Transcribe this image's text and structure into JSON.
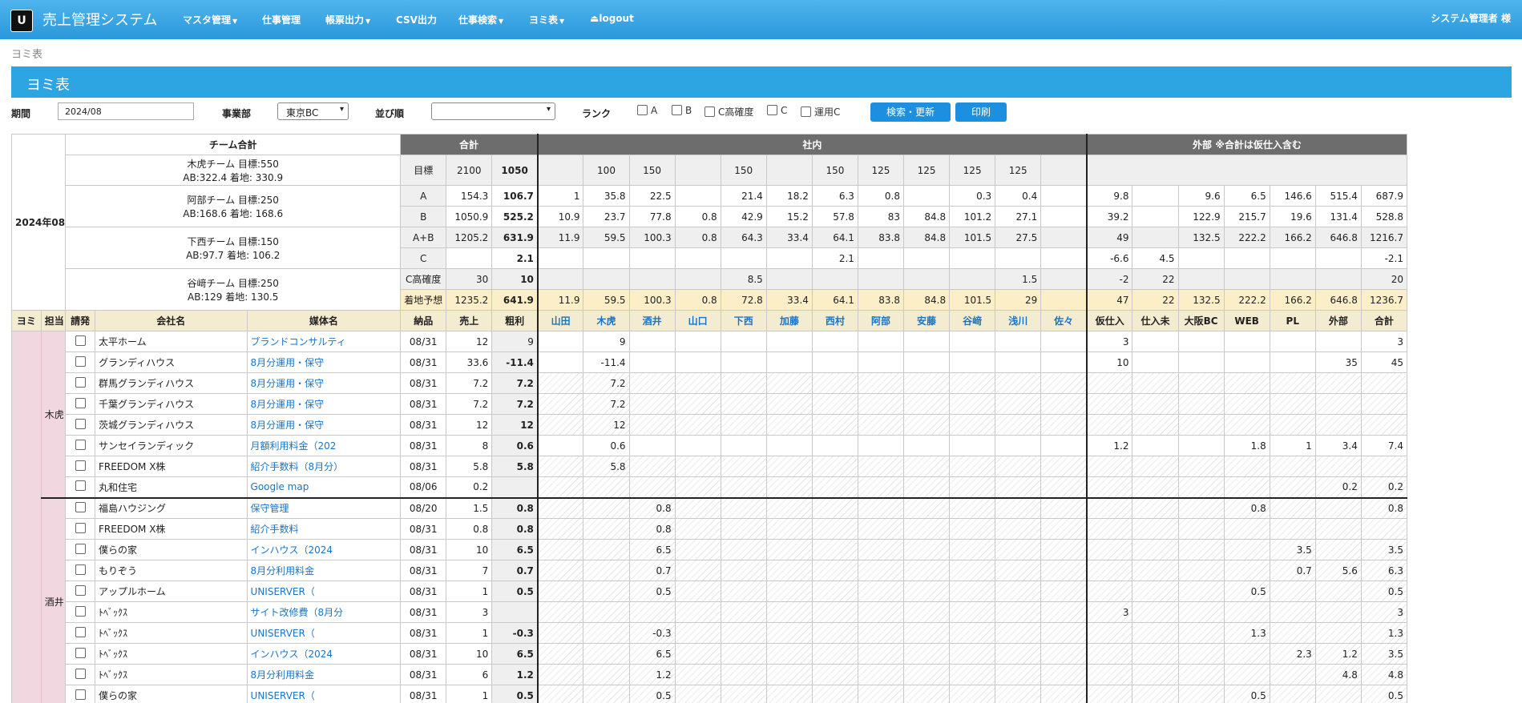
{
  "app": {
    "logo": "U",
    "title": "売上管理システム",
    "user": "システム管理者 様"
  },
  "nav": [
    {
      "label": "マスタ管理",
      "dropdown": true
    },
    {
      "label": "仕事管理",
      "dropdown": false
    },
    {
      "label": "帳票出力",
      "dropdown": true
    },
    {
      "label": "CSV出力",
      "dropdown": false
    },
    {
      "label": "仕事検索",
      "dropdown": true
    },
    {
      "label": "ヨミ表",
      "dropdown": true
    },
    {
      "label": "logout",
      "dropdown": false,
      "icon": "eject-icon"
    }
  ],
  "breadcrumb": "ヨミ表",
  "page_title": "ヨミ表",
  "filters": {
    "period_label": "期間",
    "period_value": "2024/08",
    "division_label": "事業部",
    "division_value": "東京BC",
    "sort_label": "並び順",
    "sort_value": "",
    "rank_label": "ランク",
    "rank_options": [
      "A",
      "B",
      "C高確度",
      "C",
      "運用C"
    ],
    "search_button": "検索・更新",
    "print_button": "印刷"
  },
  "summary": {
    "month": "2024年08月",
    "team_header": "チーム合計",
    "teams": [
      {
        "line1": "木虎チーム 目標:550",
        "line2": "AB:322.4 着地: 330.9"
      },
      {
        "line1": "阿部チーム 目標:250",
        "line2": "AB:168.6 着地: 168.6"
      },
      {
        "line1": "下西チーム 目標:150",
        "line2": "AB:97.7 着地: 106.2"
      },
      {
        "line1": "谷﨑チーム 目標:250",
        "line2": "AB:129 着地: 130.5"
      }
    ],
    "group_headers": {
      "total": "合計",
      "internal": "社内",
      "external": "外部 ※合計は仮仕入含む"
    },
    "rows": [
      {
        "label": "目標",
        "total": [
          "2100",
          "1050"
        ],
        "internal": [
          "",
          "100",
          "150",
          "",
          "150",
          "",
          "150",
          "125",
          "125",
          "125",
          "125",
          ""
        ],
        "external": [
          "",
          "",
          "",
          "",
          "",
          "",
          ""
        ]
      },
      {
        "label": "A",
        "total": [
          "154.3",
          "106.7"
        ],
        "internal": [
          "1",
          "35.8",
          "22.5",
          "",
          "21.4",
          "18.2",
          "6.3",
          "0.8",
          "",
          "0.3",
          "0.4",
          ""
        ],
        "external": [
          "9.8",
          "",
          "9.6",
          "6.5",
          "146.6",
          "515.4",
          "687.9"
        ]
      },
      {
        "label": "B",
        "total": [
          "1050.9",
          "525.2"
        ],
        "internal": [
          "10.9",
          "23.7",
          "77.8",
          "0.8",
          "42.9",
          "15.2",
          "57.8",
          "83",
          "84.8",
          "101.2",
          "27.1",
          ""
        ],
        "external": [
          "39.2",
          "",
          "122.9",
          "215.7",
          "19.6",
          "131.4",
          "528.8"
        ]
      },
      {
        "label": "A+B",
        "total": [
          "1205.2",
          "631.9"
        ],
        "internal": [
          "11.9",
          "59.5",
          "100.3",
          "0.8",
          "64.3",
          "33.4",
          "64.1",
          "83.8",
          "84.8",
          "101.5",
          "27.5",
          ""
        ],
        "external": [
          "49",
          "",
          "132.5",
          "222.2",
          "166.2",
          "646.8",
          "1216.7"
        ]
      },
      {
        "label": "C",
        "total": [
          "",
          "2.1"
        ],
        "internal": [
          "",
          "",
          "",
          "",
          "",
          "",
          "2.1",
          "",
          "",
          "",
          "",
          ""
        ],
        "external": [
          "-6.6",
          "4.5",
          "",
          "",
          "",
          "",
          "-2.1"
        ]
      },
      {
        "label": "C高確度",
        "total": [
          "30",
          "10"
        ],
        "internal": [
          "",
          "",
          "",
          "",
          "8.5",
          "",
          "",
          "",
          "",
          "",
          "1.5",
          ""
        ],
        "external": [
          "-2",
          "22",
          "",
          "",
          "",
          "",
          "20"
        ]
      },
      {
        "label": "着地予想",
        "total": [
          "1235.2",
          "641.9"
        ],
        "internal": [
          "11.9",
          "59.5",
          "100.3",
          "0.8",
          "72.8",
          "33.4",
          "64.1",
          "83.8",
          "84.8",
          "101.5",
          "29",
          ""
        ],
        "external": [
          "47",
          "22",
          "132.5",
          "222.2",
          "166.2",
          "646.8",
          "1236.7"
        ]
      }
    ]
  },
  "columns": {
    "left": [
      "ヨミ",
      "担当",
      "請発",
      "会社名",
      "媒体名",
      "納品",
      "売上",
      "粗利"
    ],
    "internal": [
      "山田",
      "木虎",
      "酒井",
      "山口",
      "下西",
      "加藤",
      "西村",
      "阿部",
      "安藤",
      "谷﨑",
      "浅川",
      "佐々"
    ],
    "external": [
      "仮仕入",
      "仕入未",
      "大阪BC",
      "WEB",
      "PL",
      "外部",
      "合計"
    ]
  },
  "groups": [
    {
      "person": "木虎",
      "rows": [
        {
          "company": "太平ホーム",
          "media": "ブランドコンサルティ",
          "date": "08/31",
          "sales": "12",
          "profit": "9",
          "profit_bold": false,
          "hatched": false,
          "internal": [
            "",
            "9",
            "",
            "",
            "",
            "",
            "",
            "",
            "",
            "",
            "",
            ""
          ],
          "external": [
            "3",
            "",
            "",
            "",
            "",
            "",
            "3"
          ]
        },
        {
          "company": "グランディハウス",
          "media": "8月分運用・保守",
          "date": "08/31",
          "sales": "33.6",
          "profit": "-11.4",
          "profit_bold": true,
          "hatched": false,
          "internal": [
            "",
            "-11.4",
            "",
            "",
            "",
            "",
            "",
            "",
            "",
            "",
            "",
            ""
          ],
          "external": [
            "10",
            "",
            "",
            "",
            "",
            "35",
            "45"
          ]
        },
        {
          "company": "群馬グランディハウス",
          "media": "8月分運用・保守",
          "date": "08/31",
          "sales": "7.2",
          "profit": "7.2",
          "profit_bold": true,
          "hatched": true,
          "internal": [
            "",
            "7.2",
            "",
            "",
            "",
            "",
            "",
            "",
            "",
            "",
            "",
            ""
          ],
          "external": [
            "",
            "",
            "",
            "",
            "",
            "",
            ""
          ]
        },
        {
          "company": "千葉グランディハウス",
          "media": "8月分運用・保守",
          "date": "08/31",
          "sales": "7.2",
          "profit": "7.2",
          "profit_bold": true,
          "hatched": true,
          "internal": [
            "",
            "7.2",
            "",
            "",
            "",
            "",
            "",
            "",
            "",
            "",
            "",
            ""
          ],
          "external": [
            "",
            "",
            "",
            "",
            "",
            "",
            ""
          ]
        },
        {
          "company": "茨城グランディハウス",
          "media": "8月分運用・保守",
          "date": "08/31",
          "sales": "12",
          "profit": "12",
          "profit_bold": true,
          "hatched": true,
          "internal": [
            "",
            "12",
            "",
            "",
            "",
            "",
            "",
            "",
            "",
            "",
            "",
            ""
          ],
          "external": [
            "",
            "",
            "",
            "",
            "",
            "",
            ""
          ]
        },
        {
          "company": "サンセイランディック",
          "media": "月額利用料金（202",
          "date": "08/31",
          "sales": "8",
          "profit": "0.6",
          "profit_bold": true,
          "hatched": false,
          "internal": [
            "",
            "0.6",
            "",
            "",
            "",
            "",
            "",
            "",
            "",
            "",
            "",
            ""
          ],
          "external": [
            "1.2",
            "",
            "",
            "1.8",
            "1",
            "3.4",
            "7.4"
          ]
        },
        {
          "company": "FREEDOM X株",
          "media": "紹介手数料（8月分）",
          "date": "08/31",
          "sales": "5.8",
          "profit": "5.8",
          "profit_bold": true,
          "hatched": true,
          "internal": [
            "",
            "5.8",
            "",
            "",
            "",
            "",
            "",
            "",
            "",
            "",
            "",
            ""
          ],
          "external": [
            "",
            "",
            "",
            "",
            "",
            "",
            ""
          ]
        },
        {
          "company": "丸和住宅",
          "media": "Google map",
          "date": "08/06",
          "sales": "0.2",
          "profit": "",
          "profit_bold": false,
          "hatched": true,
          "internal": [
            "",
            "",
            "",
            "",
            "",
            "",
            "",
            "",
            "",
            "",
            "",
            ""
          ],
          "external": [
            "",
            "",
            "",
            "",
            "",
            "0.2",
            "0.2"
          ]
        }
      ]
    },
    {
      "person": "酒井",
      "rows": [
        {
          "company": "福島ハウジング",
          "media": "保守管理",
          "date": "08/20",
          "sales": "1.5",
          "profit": "0.8",
          "profit_bold": true,
          "hatched": true,
          "internal": [
            "",
            "",
            "0.8",
            "",
            "",
            "",
            "",
            "",
            "",
            "",
            "",
            ""
          ],
          "external": [
            "",
            "",
            "",
            "0.8",
            "",
            "",
            "0.8"
          ]
        },
        {
          "company": "FREEDOM X株",
          "media": "紹介手数料",
          "date": "08/31",
          "sales": "0.8",
          "profit": "0.8",
          "profit_bold": true,
          "hatched": true,
          "internal": [
            "",
            "",
            "0.8",
            "",
            "",
            "",
            "",
            "",
            "",
            "",
            "",
            ""
          ],
          "external": [
            "",
            "",
            "",
            "",
            "",
            "",
            ""
          ]
        },
        {
          "company": "僕らの家",
          "media": "インハウス（2024",
          "date": "08/31",
          "sales": "10",
          "profit": "6.5",
          "profit_bold": true,
          "hatched": true,
          "internal": [
            "",
            "",
            "6.5",
            "",
            "",
            "",
            "",
            "",
            "",
            "",
            "",
            ""
          ],
          "external": [
            "",
            "",
            "",
            "",
            "3.5",
            "",
            "3.5"
          ]
        },
        {
          "company": "もりぞう",
          "media": "8月分利用料金",
          "date": "08/31",
          "sales": "7",
          "profit": "0.7",
          "profit_bold": true,
          "hatched": true,
          "internal": [
            "",
            "",
            "0.7",
            "",
            "",
            "",
            "",
            "",
            "",
            "",
            "",
            ""
          ],
          "external": [
            "",
            "",
            "",
            "",
            "0.7",
            "5.6",
            "6.3"
          ]
        },
        {
          "company": "アップルホーム",
          "media": "UNISERVER（",
          "date": "08/31",
          "sales": "1",
          "profit": "0.5",
          "profit_bold": true,
          "hatched": true,
          "internal": [
            "",
            "",
            "0.5",
            "",
            "",
            "",
            "",
            "",
            "",
            "",
            "",
            ""
          ],
          "external": [
            "",
            "",
            "",
            "0.5",
            "",
            "",
            "0.5"
          ]
        },
        {
          "company": "ﾄﾍﾞｯｸｽ",
          "media": "サイト改修費（8月分",
          "date": "08/31",
          "sales": "3",
          "profit": "",
          "profit_bold": false,
          "hatched": true,
          "internal": [
            "",
            "",
            "",
            "",
            "",
            "",
            "",
            "",
            "",
            "",
            "",
            ""
          ],
          "external": [
            "3",
            "",
            "",
            "",
            "",
            "",
            "3"
          ]
        },
        {
          "company": "ﾄﾍﾞｯｸｽ",
          "media": "UNISERVER（",
          "date": "08/31",
          "sales": "1",
          "profit": "-0.3",
          "profit_bold": true,
          "hatched": true,
          "internal": [
            "",
            "",
            "-0.3",
            "",
            "",
            "",
            "",
            "",
            "",
            "",
            "",
            ""
          ],
          "external": [
            "",
            "",
            "",
            "1.3",
            "",
            "",
            "1.3"
          ]
        },
        {
          "company": "ﾄﾍﾞｯｸｽ",
          "media": "インハウス（2024",
          "date": "08/31",
          "sales": "10",
          "profit": "6.5",
          "profit_bold": true,
          "hatched": true,
          "internal": [
            "",
            "",
            "6.5",
            "",
            "",
            "",
            "",
            "",
            "",
            "",
            "",
            ""
          ],
          "external": [
            "",
            "",
            "",
            "",
            "2.3",
            "1.2",
            "3.5"
          ]
        },
        {
          "company": "ﾄﾍﾞｯｸｽ",
          "media": "8月分利用料金",
          "date": "08/31",
          "sales": "6",
          "profit": "1.2",
          "profit_bold": true,
          "hatched": true,
          "internal": [
            "",
            "",
            "1.2",
            "",
            "",
            "",
            "",
            "",
            "",
            "",
            "",
            ""
          ],
          "external": [
            "",
            "",
            "",
            "",
            "",
            "4.8",
            "4.8"
          ]
        },
        {
          "company": "僕らの家",
          "media": "UNISERVER（",
          "date": "08/31",
          "sales": "1",
          "profit": "0.5",
          "profit_bold": true,
          "hatched": true,
          "internal": [
            "",
            "",
            "0.5",
            "",
            "",
            "",
            "",
            "",
            "",
            "",
            "",
            ""
          ],
          "external": [
            "",
            "",
            "",
            "0.5",
            "",
            "",
            "0.5"
          ]
        }
      ]
    }
  ]
}
